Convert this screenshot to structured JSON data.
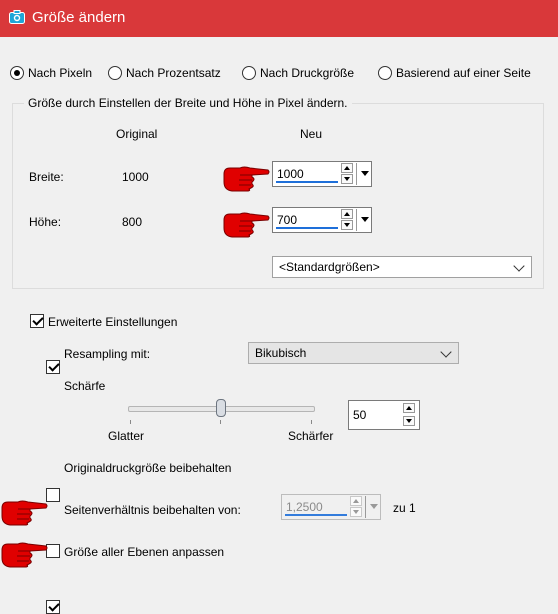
{
  "window": {
    "title": "Größe ändern"
  },
  "mode_options": [
    {
      "label": "Nach Pixeln",
      "selected": true
    },
    {
      "label": "Nach Prozentsatz",
      "selected": false
    },
    {
      "label": "Nach Druckgröße",
      "selected": false
    },
    {
      "label": "Basierend auf einer Seite",
      "selected": false
    }
  ],
  "pixel_group": {
    "title": "Größe durch Einstellen der Breite und Höhe in Pixel ändern.",
    "col_original": "Original",
    "col_new": "Neu",
    "width_label": "Breite:",
    "width_original": "1000",
    "width_new": "1000",
    "height_label": "Höhe:",
    "height_original": "800",
    "height_new": "700",
    "preset_select": "<Standardgrößen>"
  },
  "advanced": {
    "label": "Erweiterte Einstellungen",
    "checked": true,
    "resampling_label": "Resampling mit:",
    "resampling_checked": true,
    "resampling_value": "Bikubisch",
    "sharpness_label": "Schärfe",
    "slider_min_label": "Glatter",
    "slider_max_label": "Schärfer",
    "sharpness_value": "50",
    "sharpness_level": 0.5,
    "keep_print_size_label": "Originaldruckgröße beibehalten",
    "keep_print_size_checked": false,
    "aspect_label": "Seitenverhältnis beibehalten von:",
    "aspect_checked": false,
    "aspect_value": "1,2500",
    "aspect_suffix": "zu 1",
    "all_layers_label": "Größe aller Ebenen anpassen",
    "all_layers_checked": true
  },
  "icons": {
    "title": "camera-icon",
    "pointer": "pointing-hand-icon"
  },
  "colors": {
    "titlebar": "#d9383a",
    "focus_underline": "#1e6fd9",
    "hand": "#e00000"
  }
}
